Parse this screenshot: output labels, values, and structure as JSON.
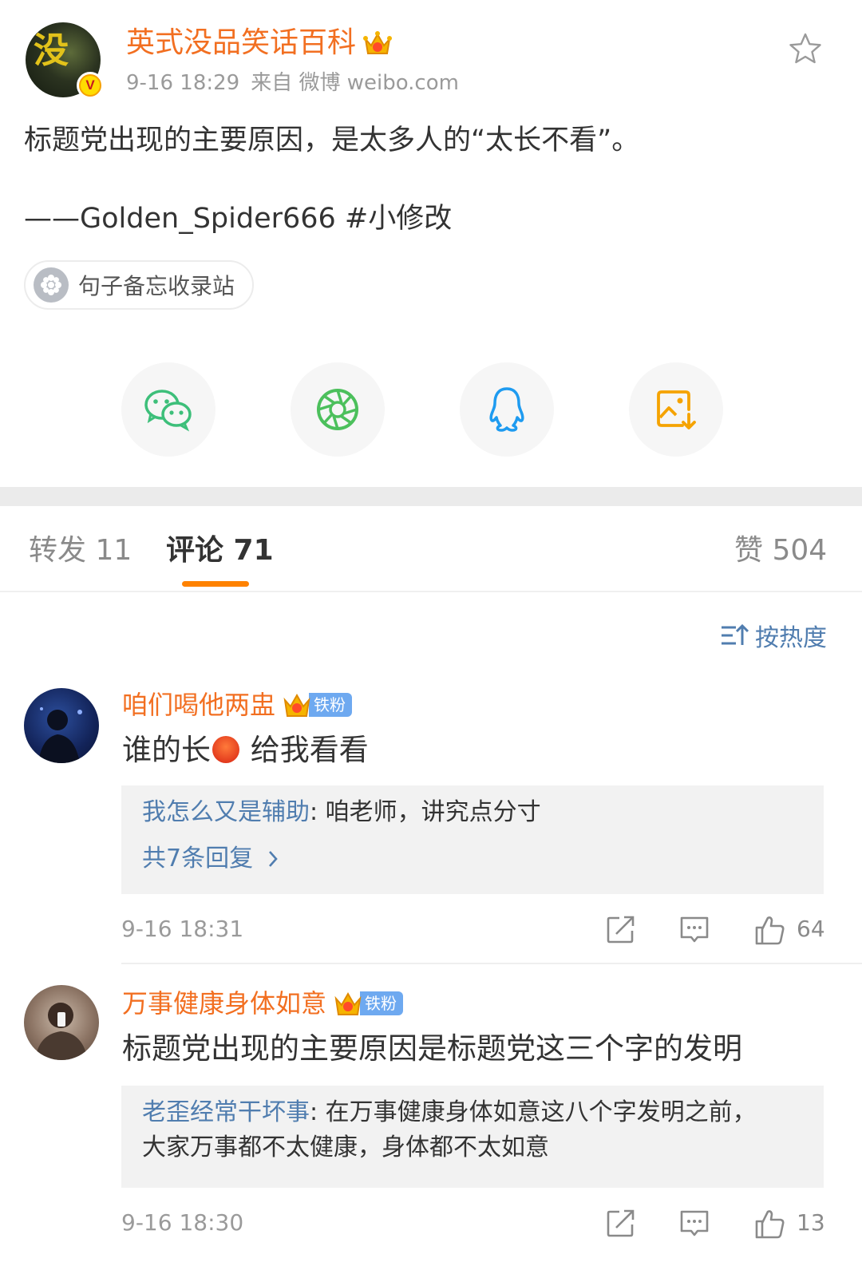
{
  "post": {
    "author": "英式没品笑话百科",
    "avatar_text": "没",
    "verified_badge": "V",
    "time": "9-16 18:29",
    "source": "来自 微博 weibo.com",
    "text_line1": "标题党出现的主要原因，是太多人的“太长不看”。",
    "text_line2": "——Golden_Spider666 #小修改",
    "tag_label": "句子备忘收录站",
    "share": [
      "wechat-icon",
      "moments-icon",
      "qq-icon",
      "save-image-icon"
    ],
    "colors": {
      "accent": "#f26f21",
      "link": "#507daf",
      "tab_underline": "#ff8200"
    }
  },
  "tabs": {
    "repost": "转发 11",
    "comments": "评论 71",
    "likes": "赞 504"
  },
  "sort": {
    "label": "按热度"
  },
  "comments": [
    {
      "name": "咱们喝他两盅",
      "badge": "铁粉",
      "text_before_emoji": "谁的长",
      "text_after_emoji": "给我看看",
      "reply_user": "我怎么又是辅助",
      "reply_text": ": 咱老师，讲究点分寸",
      "more_replies": "共7条回复",
      "time": "9-16 18:31",
      "likes": "64"
    },
    {
      "name": "万事健康身体如意",
      "badge": "铁粉",
      "text": "标题党出现的主要原因是标题党这三个字的发明",
      "reply_user": "老歪经常干坏事",
      "reply_text_line1": ": 在万事健康身体如意这八个字发明之前，",
      "reply_text_line2": "大家万事都不太健康，身体都不太如意",
      "time": "9-16 18:30",
      "likes": "13"
    }
  ]
}
